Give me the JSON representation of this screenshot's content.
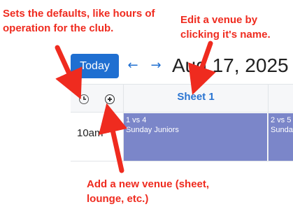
{
  "annotations": {
    "defaults": "Sets the defaults, like hours of operation for the club.",
    "edit_venue": "Edit a venue by clicking it's name.",
    "add_venue": "Add a new venue (sheet, lounge, etc.)"
  },
  "toolbar": {
    "today_label": "Today",
    "prev_symbol": "←",
    "next_symbol": "→",
    "date_title": "Aug 17, 2025"
  },
  "header": {
    "venue_name": "Sheet 1"
  },
  "rows": [
    {
      "time": "10am"
    }
  ],
  "events": [
    {
      "title": "1 vs 4",
      "subtitle": "Sunday Juniors"
    },
    {
      "title": "2 vs 5",
      "subtitle": "Sunday"
    }
  ],
  "colors": {
    "annotation": "#ef2b1f",
    "primary": "#1f6fd1",
    "event": "#7b86c9"
  },
  "icons": {
    "clock": "clock-icon",
    "add": "add-circle-icon"
  }
}
